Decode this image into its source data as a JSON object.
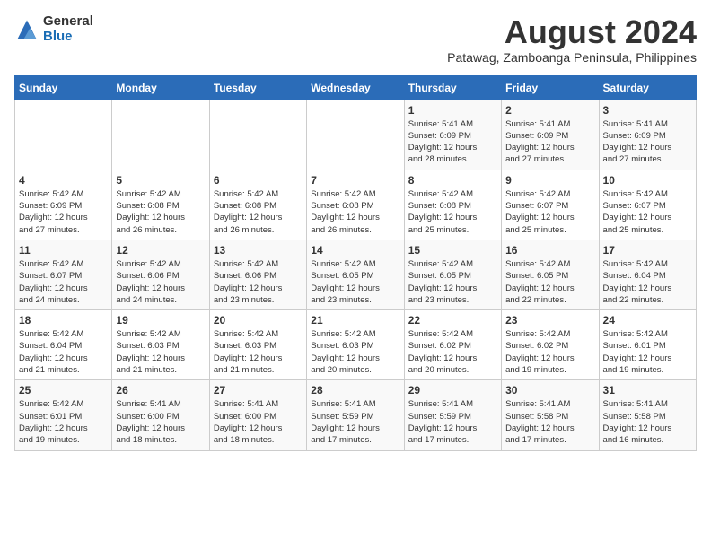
{
  "logo": {
    "general": "General",
    "blue": "Blue"
  },
  "title": "August 2024",
  "subtitle": "Patawag, Zamboanga Peninsula, Philippines",
  "days_of_week": [
    "Sunday",
    "Monday",
    "Tuesday",
    "Wednesday",
    "Thursday",
    "Friday",
    "Saturday"
  ],
  "weeks": [
    [
      {
        "day": "",
        "info": ""
      },
      {
        "day": "",
        "info": ""
      },
      {
        "day": "",
        "info": ""
      },
      {
        "day": "",
        "info": ""
      },
      {
        "day": "1",
        "info": "Sunrise: 5:41 AM\nSunset: 6:09 PM\nDaylight: 12 hours\nand 28 minutes."
      },
      {
        "day": "2",
        "info": "Sunrise: 5:41 AM\nSunset: 6:09 PM\nDaylight: 12 hours\nand 27 minutes."
      },
      {
        "day": "3",
        "info": "Sunrise: 5:41 AM\nSunset: 6:09 PM\nDaylight: 12 hours\nand 27 minutes."
      }
    ],
    [
      {
        "day": "4",
        "info": "Sunrise: 5:42 AM\nSunset: 6:09 PM\nDaylight: 12 hours\nand 27 minutes."
      },
      {
        "day": "5",
        "info": "Sunrise: 5:42 AM\nSunset: 6:08 PM\nDaylight: 12 hours\nand 26 minutes."
      },
      {
        "day": "6",
        "info": "Sunrise: 5:42 AM\nSunset: 6:08 PM\nDaylight: 12 hours\nand 26 minutes."
      },
      {
        "day": "7",
        "info": "Sunrise: 5:42 AM\nSunset: 6:08 PM\nDaylight: 12 hours\nand 26 minutes."
      },
      {
        "day": "8",
        "info": "Sunrise: 5:42 AM\nSunset: 6:08 PM\nDaylight: 12 hours\nand 25 minutes."
      },
      {
        "day": "9",
        "info": "Sunrise: 5:42 AM\nSunset: 6:07 PM\nDaylight: 12 hours\nand 25 minutes."
      },
      {
        "day": "10",
        "info": "Sunrise: 5:42 AM\nSunset: 6:07 PM\nDaylight: 12 hours\nand 25 minutes."
      }
    ],
    [
      {
        "day": "11",
        "info": "Sunrise: 5:42 AM\nSunset: 6:07 PM\nDaylight: 12 hours\nand 24 minutes."
      },
      {
        "day": "12",
        "info": "Sunrise: 5:42 AM\nSunset: 6:06 PM\nDaylight: 12 hours\nand 24 minutes."
      },
      {
        "day": "13",
        "info": "Sunrise: 5:42 AM\nSunset: 6:06 PM\nDaylight: 12 hours\nand 23 minutes."
      },
      {
        "day": "14",
        "info": "Sunrise: 5:42 AM\nSunset: 6:05 PM\nDaylight: 12 hours\nand 23 minutes."
      },
      {
        "day": "15",
        "info": "Sunrise: 5:42 AM\nSunset: 6:05 PM\nDaylight: 12 hours\nand 23 minutes."
      },
      {
        "day": "16",
        "info": "Sunrise: 5:42 AM\nSunset: 6:05 PM\nDaylight: 12 hours\nand 22 minutes."
      },
      {
        "day": "17",
        "info": "Sunrise: 5:42 AM\nSunset: 6:04 PM\nDaylight: 12 hours\nand 22 minutes."
      }
    ],
    [
      {
        "day": "18",
        "info": "Sunrise: 5:42 AM\nSunset: 6:04 PM\nDaylight: 12 hours\nand 21 minutes."
      },
      {
        "day": "19",
        "info": "Sunrise: 5:42 AM\nSunset: 6:03 PM\nDaylight: 12 hours\nand 21 minutes."
      },
      {
        "day": "20",
        "info": "Sunrise: 5:42 AM\nSunset: 6:03 PM\nDaylight: 12 hours\nand 21 minutes."
      },
      {
        "day": "21",
        "info": "Sunrise: 5:42 AM\nSunset: 6:03 PM\nDaylight: 12 hours\nand 20 minutes."
      },
      {
        "day": "22",
        "info": "Sunrise: 5:42 AM\nSunset: 6:02 PM\nDaylight: 12 hours\nand 20 minutes."
      },
      {
        "day": "23",
        "info": "Sunrise: 5:42 AM\nSunset: 6:02 PM\nDaylight: 12 hours\nand 19 minutes."
      },
      {
        "day": "24",
        "info": "Sunrise: 5:42 AM\nSunset: 6:01 PM\nDaylight: 12 hours\nand 19 minutes."
      }
    ],
    [
      {
        "day": "25",
        "info": "Sunrise: 5:42 AM\nSunset: 6:01 PM\nDaylight: 12 hours\nand 19 minutes."
      },
      {
        "day": "26",
        "info": "Sunrise: 5:41 AM\nSunset: 6:00 PM\nDaylight: 12 hours\nand 18 minutes."
      },
      {
        "day": "27",
        "info": "Sunrise: 5:41 AM\nSunset: 6:00 PM\nDaylight: 12 hours\nand 18 minutes."
      },
      {
        "day": "28",
        "info": "Sunrise: 5:41 AM\nSunset: 5:59 PM\nDaylight: 12 hours\nand 17 minutes."
      },
      {
        "day": "29",
        "info": "Sunrise: 5:41 AM\nSunset: 5:59 PM\nDaylight: 12 hours\nand 17 minutes."
      },
      {
        "day": "30",
        "info": "Sunrise: 5:41 AM\nSunset: 5:58 PM\nDaylight: 12 hours\nand 17 minutes."
      },
      {
        "day": "31",
        "info": "Sunrise: 5:41 AM\nSunset: 5:58 PM\nDaylight: 12 hours\nand 16 minutes."
      }
    ]
  ]
}
